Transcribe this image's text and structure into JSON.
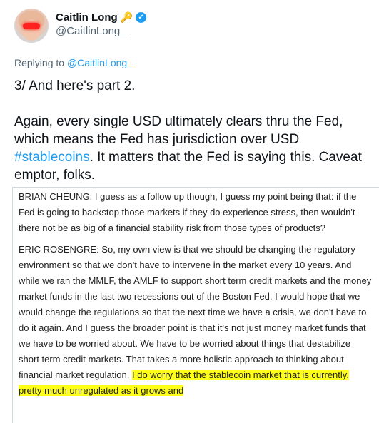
{
  "author": {
    "display_name": "Caitlin Long",
    "handle": "@CaitlinLong_",
    "icons": [
      "key-icon",
      "verified-icon"
    ]
  },
  "reply": {
    "prefix": "Replying to",
    "mention": "@CaitlinLong_"
  },
  "tweet": {
    "line1": "3/ And here's part 2.",
    "body_before": "Again, every single USD ultimately clears thru the Fed, which means the Fed has jurisdiction over USD ",
    "hashtag": "#stablecoins",
    "body_after": ". It matters that the Fed is saying this. Caveat emptor, folks."
  },
  "transcript": {
    "para1": "BRIAN CHEUNG: I guess as a follow up though, I guess my point being that: if the Fed is going to backstop those markets if they do experience stress, then wouldn't there not be as big of a financial stability risk from those types of products?",
    "para2": "ERIC ROSENGRE: So, my own view is that we should be changing the regulatory environment so that we don't have to intervene in the market every 10 years. And while we ran the MMLF, the AMLF to support short term credit markets and the money market funds in the last two recessions out of the Boston Fed, I would hope that we would change the regulations so that the next time we have a crisis, we don't have to do it again. And I guess the broader point is that it's not just money market funds that we have to be worried about. We have to be worried about things that destabilize short term credit markets. That takes a more holistic approach to thinking about financial market regulation. ",
    "para2_highlight": "I do worry that the stablecoin market that is currently, pretty much unregulated as it grows and"
  },
  "colors": {
    "accent": "#1d9bf0",
    "highlight": "#ffff1a",
    "muted": "#536471"
  }
}
